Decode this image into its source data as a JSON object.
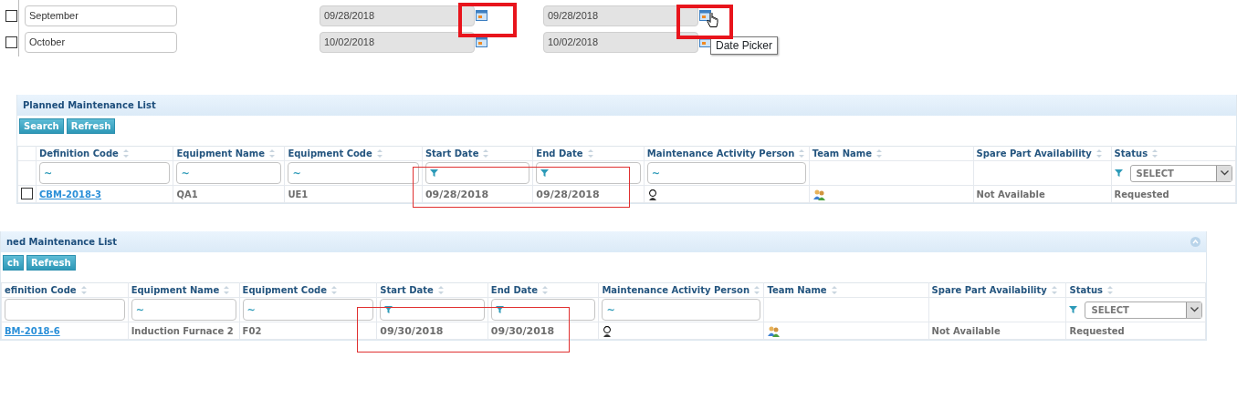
{
  "date_rows": [
    {
      "checked": false,
      "month": "September",
      "start": "09/28/2018",
      "end": "09/28/2018"
    },
    {
      "checked": false,
      "month": "October",
      "start": "10/02/2018",
      "end": "10/02/2018"
    }
  ],
  "tooltip": "Date Picker",
  "panels": [
    {
      "title": "Planned Maintenance List",
      "buttons": [
        "Search",
        "Refresh"
      ],
      "columns": [
        {
          "label": "Definition Code",
          "filter": {
            "kind": "text",
            "value": "~"
          }
        },
        {
          "label": "Equipment Name",
          "filter": {
            "kind": "text",
            "value": "~"
          }
        },
        {
          "label": "Equipment Code",
          "filter": {
            "kind": "text",
            "value": "~"
          }
        },
        {
          "label": "Start Date",
          "filter": {
            "kind": "date"
          }
        },
        {
          "label": "End Date",
          "filter": {
            "kind": "date"
          }
        },
        {
          "label": "Maintenance Activity Person",
          "filter": {
            "kind": "text",
            "value": "~"
          }
        },
        {
          "label": "Team Name"
        },
        {
          "label": "Spare Part Availability"
        },
        {
          "label": "Status",
          "filter": {
            "kind": "select",
            "value": "SELECT"
          }
        }
      ],
      "rows": [
        {
          "checked": false,
          "cells": [
            {
              "kind": "link",
              "text": "CBM-2018-3"
            },
            {
              "kind": "text",
              "text": "QA1"
            },
            {
              "kind": "text",
              "text": "UE1"
            },
            {
              "kind": "date",
              "text": "09/28/2018"
            },
            {
              "kind": "date",
              "text": "09/28/2018"
            },
            {
              "kind": "person"
            },
            {
              "kind": "team"
            },
            {
              "kind": "text",
              "text": "Not Available"
            },
            {
              "kind": "text",
              "text": "Requested"
            }
          ]
        }
      ]
    },
    {
      "title": "ned Maintenance List",
      "collapse_button": true,
      "buttons": [
        "ch",
        "Refresh"
      ],
      "columns": [
        {
          "label": "efinition Code",
          "filter": {
            "kind": "text"
          }
        },
        {
          "label": "Equipment Name",
          "filter": {
            "kind": "text",
            "value": "~"
          }
        },
        {
          "label": "Equipment Code",
          "filter": {
            "kind": "text",
            "value": "~"
          }
        },
        {
          "label": "Start Date",
          "filter": {
            "kind": "date"
          }
        },
        {
          "label": "End Date",
          "filter": {
            "kind": "date"
          }
        },
        {
          "label": "Maintenance Activity Person",
          "filter": {
            "kind": "text",
            "value": "~"
          }
        },
        {
          "label": "Team Name"
        },
        {
          "label": "Spare Part Availability"
        },
        {
          "label": "Status",
          "filter": {
            "kind": "select",
            "value": "SELECT"
          }
        }
      ],
      "rows": [
        {
          "cells": [
            {
              "kind": "link",
              "text": "BM-2018-6"
            },
            {
              "kind": "text",
              "text": "Induction Furnace 2"
            },
            {
              "kind": "text",
              "text": "F02"
            },
            {
              "kind": "date",
              "text": "09/30/2018"
            },
            {
              "kind": "date",
              "text": "09/30/2018"
            },
            {
              "kind": "person"
            },
            {
              "kind": "team"
            },
            {
              "kind": "text",
              "text": "Not Available"
            },
            {
              "kind": "text",
              "text": "Requested"
            }
          ]
        }
      ]
    }
  ]
}
